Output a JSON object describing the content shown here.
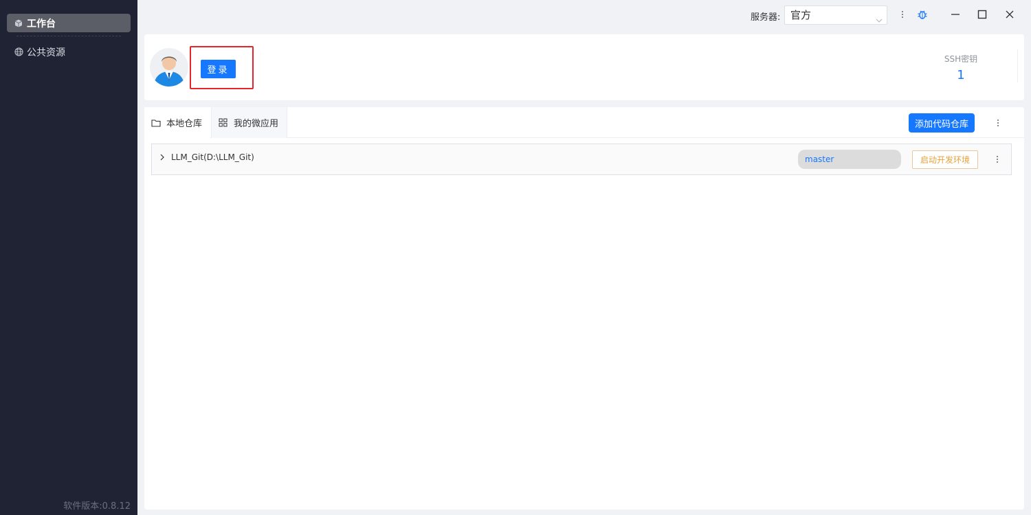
{
  "sidebar": {
    "items": [
      {
        "label": "工作台",
        "icon": "cube-icon",
        "active": true
      },
      {
        "label": "公共资源",
        "icon": "globe-icon",
        "active": false
      }
    ],
    "version": "软件版本:0.8.12"
  },
  "titlebar": {
    "server_label": "服务器:",
    "server_value": "官方",
    "icons": [
      "more-vertical-icon",
      "bug-icon",
      "minimize-icon",
      "maximize-icon",
      "close-icon"
    ]
  },
  "user_card": {
    "login_label": "登录",
    "ssh_label": "SSH密钥",
    "ssh_count": "1"
  },
  "tabs": [
    {
      "label": "本地仓库",
      "icon": "folder-icon",
      "active": true
    },
    {
      "label": "我的微应用",
      "icon": "grid-icon",
      "active": false
    }
  ],
  "toolbar": {
    "add_repo_label": "添加代码仓库"
  },
  "repos": [
    {
      "name": "LLM_Git(D:\\LLM_Git)",
      "branch": "master",
      "action_label": "启动开发环境"
    }
  ],
  "colors": {
    "primary": "#1677ff",
    "sidebar_bg": "#1f2333",
    "highlight_border": "#e4262a",
    "warning": "#e6a23c"
  }
}
